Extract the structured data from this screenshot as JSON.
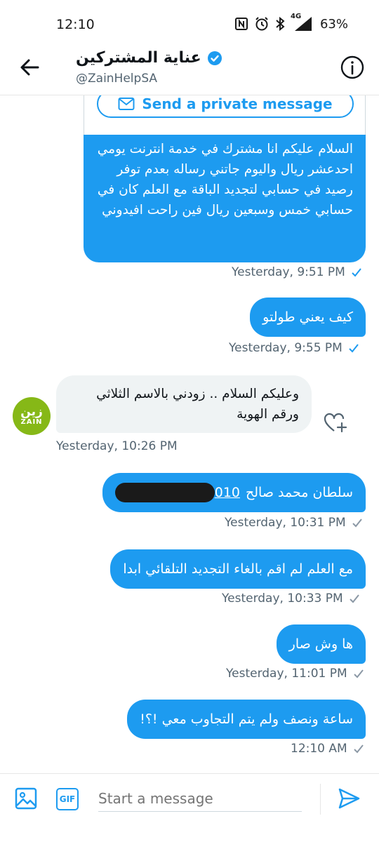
{
  "status_bar": {
    "time": "12:10",
    "network": "4G",
    "battery": "63%"
  },
  "header": {
    "name": "عناية المشتركين",
    "handle": "@ZainHelpSA"
  },
  "card": {
    "button_label": "Send a private message",
    "text": "السلام عليكم انا مشترك في خدمة انترنت يومي احدعشر ريال واليوم جاتني رساله بعدم توفر رصيد في حسابي لتجديد الباقة مع العلم كان في حسابي خمس وسبعين ريال فين راحت افيدوني",
    "time": "Yesterday, 9:51 PM"
  },
  "messages": [
    {
      "text": "كيف يعني طولتو",
      "time": "Yesterday, 9:55 PM"
    },
    {
      "text": "وعليكم السلام .. زودني بالاسم الثلاثي ورقم الهوية",
      "time": "Yesterday, 10:26 PM",
      "sender_avatar": {
        "ar": "زين",
        "en": "ZAIN"
      }
    },
    {
      "text": "سلطان محمد صالح",
      "tail": "010",
      "time": "Yesterday, 10:31 PM"
    },
    {
      "text": "مع العلم لم اقم بالغاء التجديد التلقائي ابدا",
      "time": "Yesterday, 10:33 PM"
    },
    {
      "text": "ها وش صار",
      "time": "Yesterday, 11:01 PM"
    },
    {
      "text": "ساعة ونصف ولم يتم التجاوب معي !؟!",
      "time": "12:10 AM"
    }
  ],
  "compose": {
    "placeholder": "Start a message",
    "gif_label": "GIF"
  },
  "colors": {
    "accent": "#1d9bf0",
    "incoming_bubble": "#eff3f4",
    "zain_green": "#86b817"
  },
  "icons": [
    "back-arrow-icon",
    "verified-badge-icon",
    "info-icon",
    "envelope-icon",
    "read-check-icon",
    "sent-check-icon",
    "heart-plus-icon",
    "image-icon",
    "gif-icon",
    "send-icon"
  ]
}
